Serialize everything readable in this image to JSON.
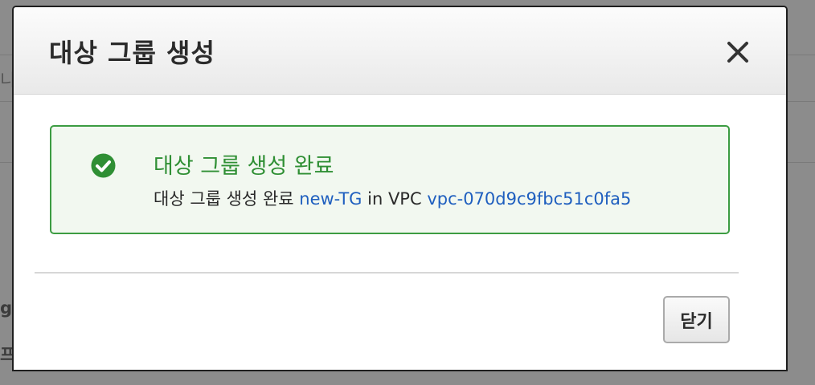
{
  "background": {
    "fragments": [
      "니",
      "g:",
      "프"
    ]
  },
  "dialog": {
    "title": "대상 그룹 생성",
    "close_icon": "close-icon",
    "alert": {
      "status": "success",
      "icon": "check-circle-icon",
      "title": "대상 그룹 생성 완료",
      "message_prefix": "대상 그룹 생성 완료",
      "target_group_link": "new-TG",
      "message_middle": "in VPC",
      "vpc_link": "vpc-070d9c9fbc51c0fa5"
    },
    "footer": {
      "close_label": "닫기"
    }
  },
  "colors": {
    "success_border": "#3c9c42",
    "success_text": "#2f8f34",
    "success_bg": "#f2f8f0",
    "link": "#1f5fbf",
    "overlay": "#8c8c8c"
  }
}
